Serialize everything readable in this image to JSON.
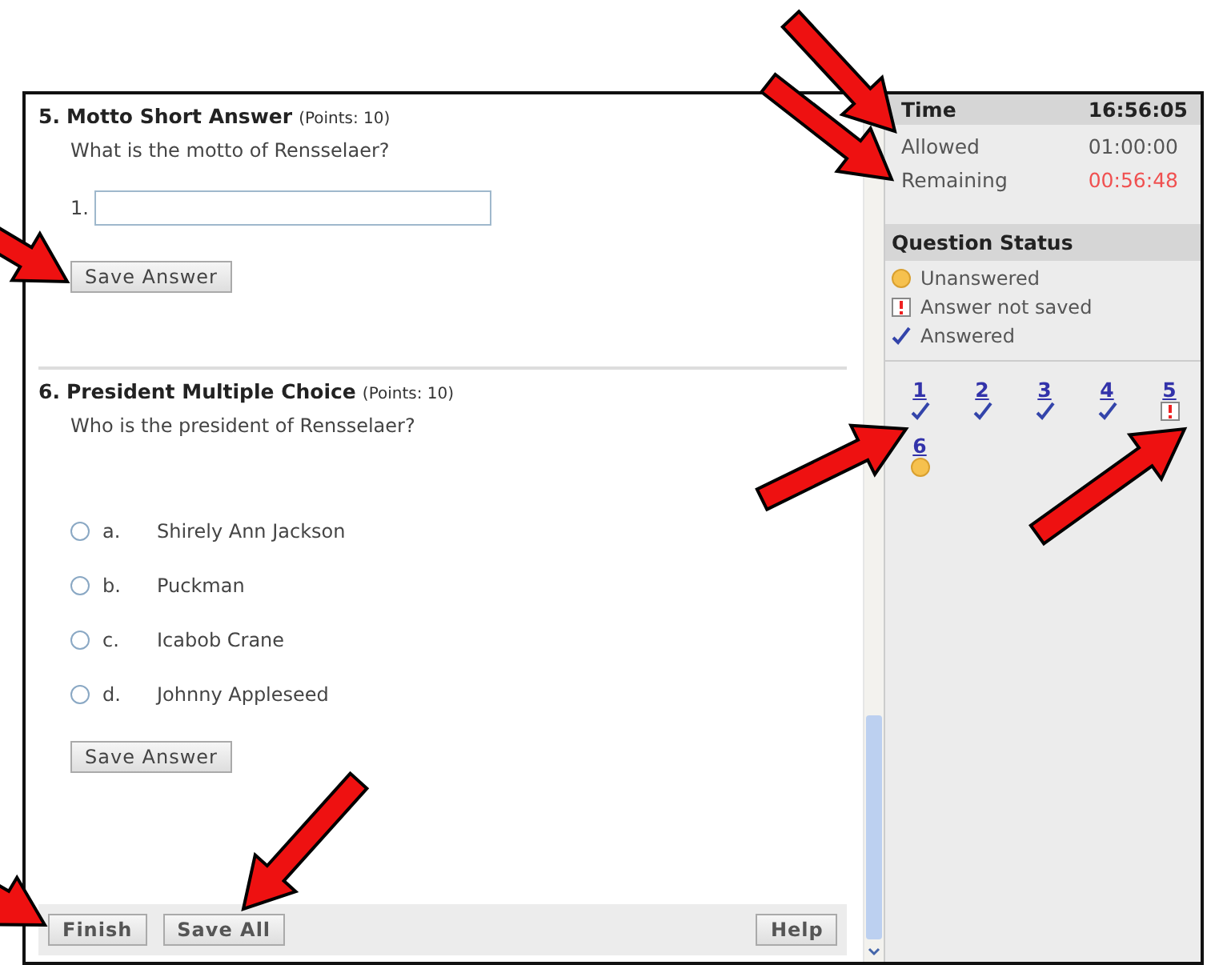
{
  "questions": [
    {
      "kind": "short_answer",
      "number": "5.",
      "title": "Motto Short Answer",
      "points": "(Points: 10)",
      "prompt": "What is the motto of Rensselaer?",
      "field_label": "1.",
      "save_button": "Save Answer"
    },
    {
      "kind": "multiple_choice",
      "number": "6.",
      "title": "President Multiple Choice",
      "points": "(Points: 10)",
      "prompt": "Who is the president of Rensselaer?",
      "options": [
        {
          "letter": "a.",
          "text": "Shirely Ann Jackson",
          "selected": false
        },
        {
          "letter": "b.",
          "text": "Puckman",
          "selected": false
        },
        {
          "letter": "c.",
          "text": "Icabob Crane",
          "selected": false
        },
        {
          "letter": "d.",
          "text": "Johnny Appleseed",
          "selected": false
        }
      ],
      "save_button": "Save Answer"
    }
  ],
  "footer": {
    "buttons": [
      "Finish",
      "Save All"
    ],
    "help": "Help"
  },
  "time": {
    "label": "Time",
    "clock": "16:56:05",
    "rows": [
      {
        "label": "Allowed",
        "value": "01:00:00",
        "warning": false
      },
      {
        "label": "Remaining",
        "value": "00:56:48",
        "warning": true
      }
    ]
  },
  "status": {
    "title": "Question Status",
    "legend": [
      {
        "kind": "unanswered",
        "label": "Unanswered"
      },
      {
        "kind": "unsaved",
        "label": "Answer not saved"
      },
      {
        "kind": "answered",
        "label": "Answered"
      }
    ],
    "questions": [
      {
        "number": "1",
        "kind": "answered"
      },
      {
        "number": "2",
        "kind": "answered"
      },
      {
        "number": "3",
        "kind": "answered"
      },
      {
        "number": "4",
        "kind": "answered"
      },
      {
        "number": "5",
        "kind": "unsaved"
      },
      {
        "number": "6",
        "kind": "unanswered"
      }
    ]
  }
}
